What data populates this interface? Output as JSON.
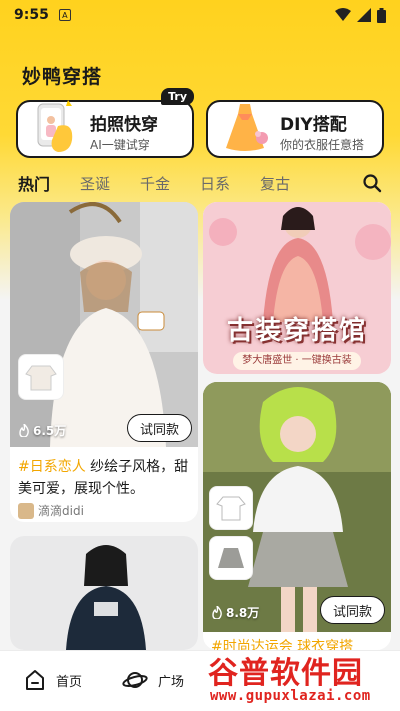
{
  "status_bar": {
    "time": "9:55",
    "notification_letter": "A"
  },
  "app": {
    "title": "妙鸭穿搭"
  },
  "features": [
    {
      "title": "拍照快穿",
      "subtitle": "AI一键试穿",
      "badge": "Try",
      "icon": "phone-hand-icon"
    },
    {
      "title": "DIY搭配",
      "subtitle": "你的衣服任意搭",
      "icon": "dress-icon"
    }
  ],
  "tabs": [
    "热门",
    "圣诞",
    "千金",
    "日系",
    "复古"
  ],
  "active_tab": "热门",
  "cards": {
    "c1": {
      "likes": "6.5万",
      "button": "试同款",
      "hashtag": "#日系恋人",
      "desc": " 纱绘子风格，甜美可爱，展现个性。",
      "author": "滴滴didi"
    },
    "c2": {
      "poster_title": "古装穿搭馆",
      "poster_sub": "梦大唐盛世 · 一键换古装"
    },
    "c3": {
      "likes": "8.8万",
      "button": "试同款",
      "desc_partial": "#时尚达运会  球衣穿搭"
    }
  },
  "bottom_nav": [
    {
      "label": "首页",
      "icon": "home-icon"
    },
    {
      "label": "广场",
      "icon": "planet-icon"
    }
  ],
  "watermark": {
    "text": "谷普软件园",
    "url": "www.gupuxlazai.com"
  },
  "colors": {
    "accent": "#ffd21e",
    "hashtag": "#f2a600",
    "watermark": "#e0241f"
  }
}
